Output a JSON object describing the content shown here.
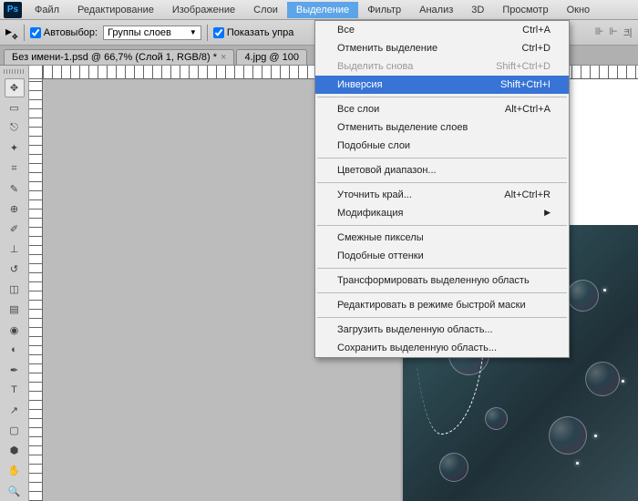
{
  "app_logo": "Ps",
  "menubar": [
    "Файл",
    "Редактирование",
    "Изображение",
    "Слои",
    "Выделение",
    "Фильтр",
    "Анализ",
    "3D",
    "Просмотр",
    "Окно"
  ],
  "active_menu_index": 4,
  "toolbar": {
    "autoselect_label": "Автовыбор:",
    "autoselect_checked": true,
    "group_dropdown": "Группы слоев",
    "show_controls_label": "Показать упра",
    "show_controls_checked": true
  },
  "tabs": [
    {
      "label": "Без имени-1.psd @ 66,7% (Слой 1, RGB/8) *"
    },
    {
      "label": "4.jpg @ 100"
    }
  ],
  "dropdown": {
    "items": [
      {
        "label": "Все",
        "shortcut": "Ctrl+A"
      },
      {
        "label": "Отменить выделение",
        "shortcut": "Ctrl+D"
      },
      {
        "label": "Выделить снова",
        "shortcut": "Shift+Ctrl+D",
        "disabled": true
      },
      {
        "label": "Инверсия",
        "shortcut": "Shift+Ctrl+I",
        "highlight": true
      },
      {
        "sep": true
      },
      {
        "label": "Все слои",
        "shortcut": "Alt+Ctrl+A"
      },
      {
        "label": "Отменить выделение слоев",
        "shortcut": ""
      },
      {
        "label": "Подобные слои",
        "shortcut": ""
      },
      {
        "sep": true
      },
      {
        "label": "Цветовой диапазон...",
        "shortcut": ""
      },
      {
        "sep": true
      },
      {
        "label": "Уточнить край...",
        "shortcut": "Alt+Ctrl+R"
      },
      {
        "label": "Модификация",
        "shortcut": "",
        "submenu": true
      },
      {
        "sep": true
      },
      {
        "label": "Смежные пикселы",
        "shortcut": ""
      },
      {
        "label": "Подобные оттенки",
        "shortcut": ""
      },
      {
        "sep": true
      },
      {
        "label": "Трансформировать выделенную область",
        "shortcut": ""
      },
      {
        "sep": true
      },
      {
        "label": "Редактировать в режиме быстрой маски",
        "shortcut": ""
      },
      {
        "sep": true
      },
      {
        "label": "Загрузить выделенную область...",
        "shortcut": ""
      },
      {
        "label": "Сохранить выделенную область...",
        "shortcut": ""
      }
    ]
  },
  "tools": [
    "move",
    "marquee",
    "lasso",
    "wand",
    "crop",
    "eyedrop",
    "heal",
    "brush",
    "stamp",
    "history",
    "eraser",
    "gradient",
    "blur",
    "dodge",
    "pen",
    "type",
    "path",
    "shape",
    "3d",
    "hand",
    "zoom"
  ]
}
